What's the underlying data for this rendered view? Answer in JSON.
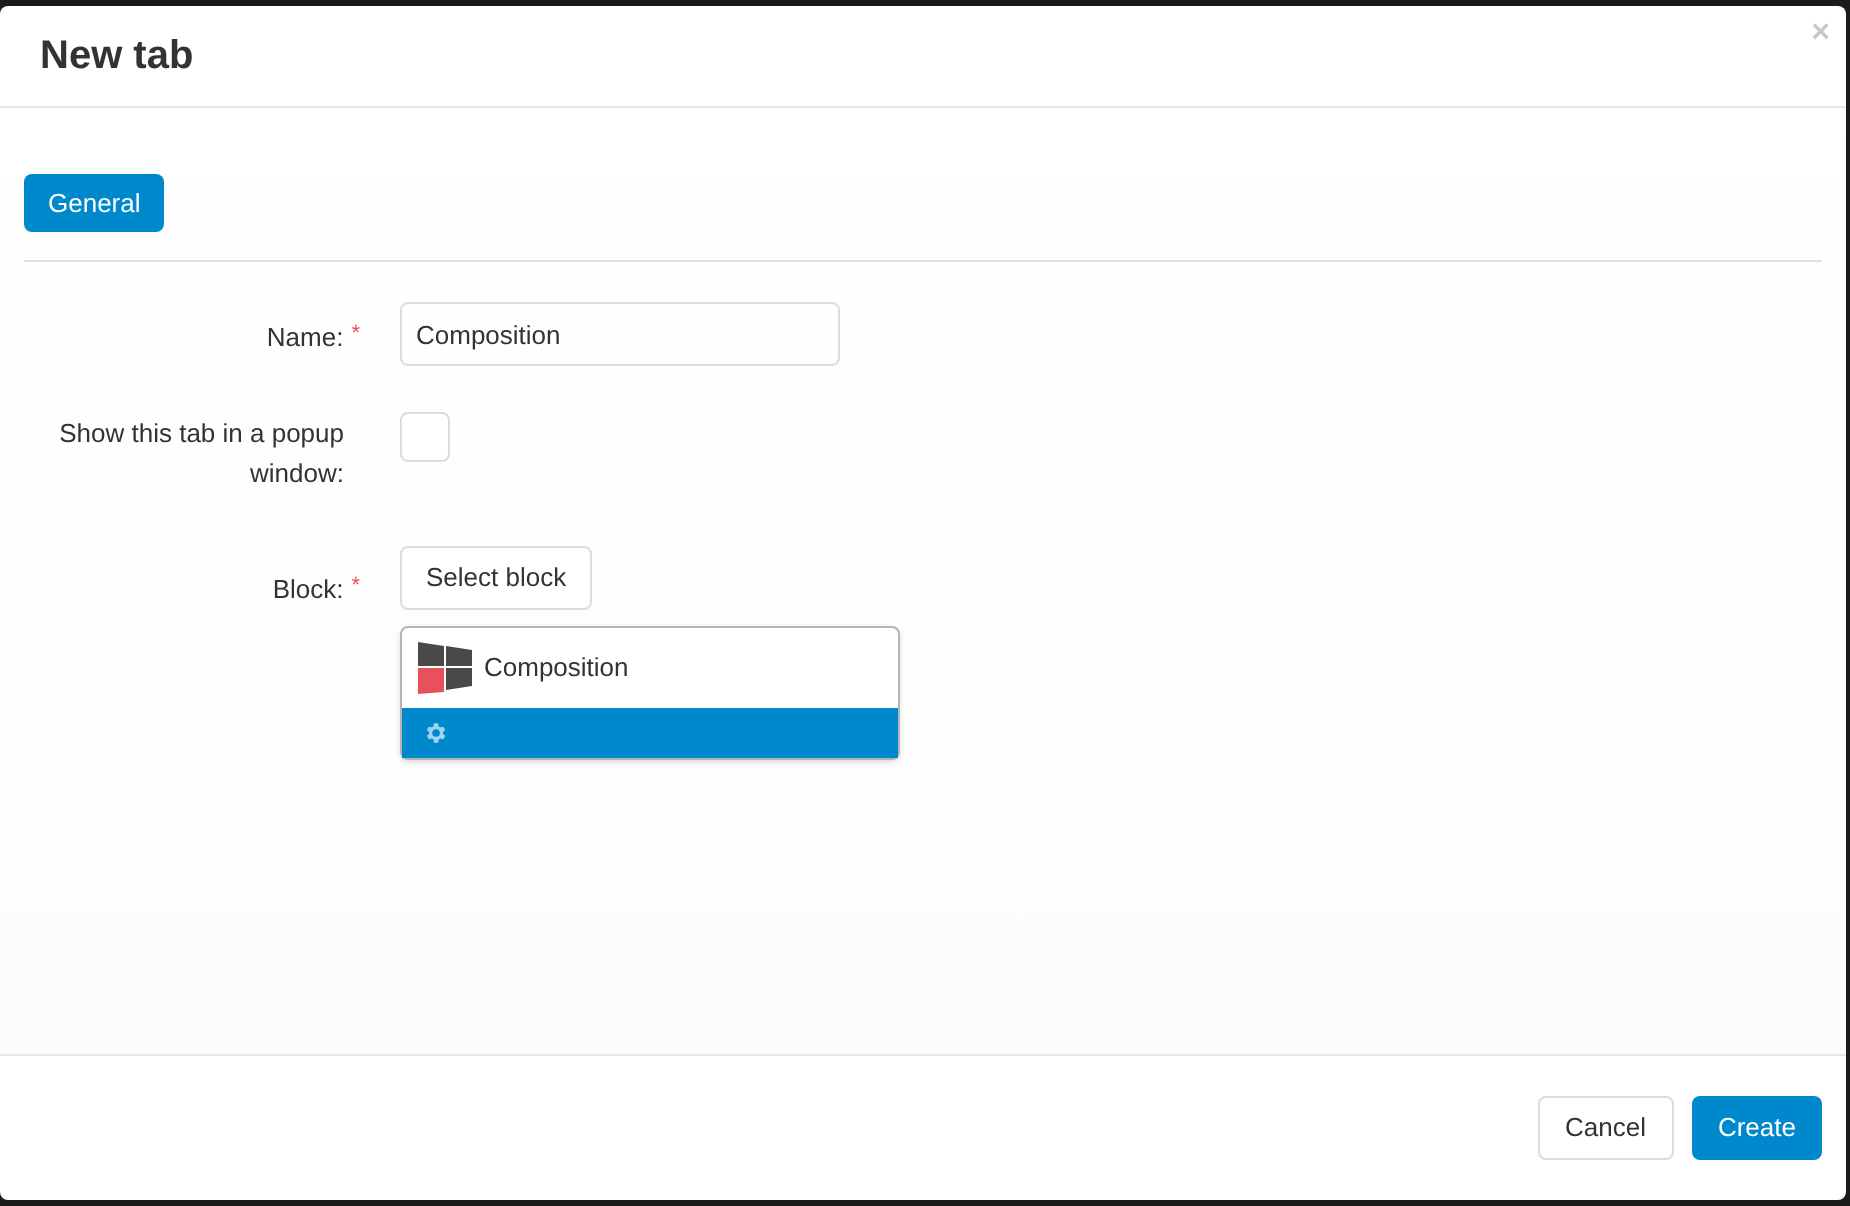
{
  "dialog": {
    "title": "New tab",
    "close": "×"
  },
  "tabs": [
    {
      "label": "General",
      "selected": true
    }
  ],
  "form": {
    "name": {
      "label": "Name:",
      "required_mark": "*",
      "value": "Composition"
    },
    "popup": {
      "label": "Show this tab in a popup window:",
      "checked": false
    },
    "block": {
      "label": "Block:",
      "required_mark": "*",
      "button": "Select block",
      "selected_block": "Composition"
    }
  },
  "buttons": [
    {
      "label": "Cancel",
      "kind": "secondary"
    },
    {
      "label": "Create",
      "kind": "primary"
    }
  ]
}
